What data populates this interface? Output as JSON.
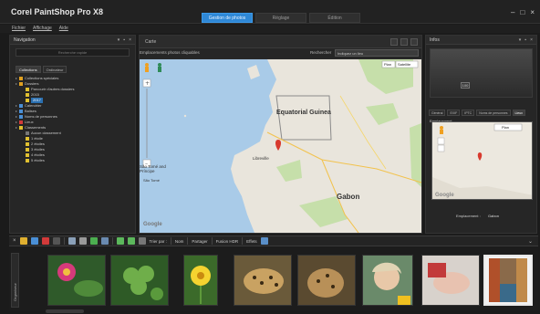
{
  "app": {
    "title": "Corel PaintShop Pro X8",
    "modes": [
      {
        "label": "Gestion de photos",
        "active": true
      },
      {
        "label": "Réglage",
        "active": false
      },
      {
        "label": "Édition",
        "active": false
      }
    ],
    "window_controls": [
      "–",
      "□",
      "×"
    ]
  },
  "menu": [
    "Fichier",
    "Affichage",
    "Aide"
  ],
  "navigation": {
    "title": "Navigation",
    "search_placeholder": "Recherche rapide",
    "tabs": [
      {
        "label": "Collections",
        "active": true
      },
      {
        "label": "Ordinateur",
        "active": false
      }
    ],
    "tree": [
      {
        "label": "Collections spéciales",
        "depth": 0,
        "icon_color": "#e0a020"
      },
      {
        "label": "Dossiers",
        "depth": 0,
        "icon_color": "#e0a020"
      },
      {
        "label": "Parcourir d'autres dossiers",
        "depth": 1,
        "icon_color": "#e0c030"
      },
      {
        "label": "2015",
        "depth": 1,
        "icon_color": "#e0c030"
      },
      {
        "label": "2017",
        "depth": 1,
        "icon_color": "#e0c030",
        "selected": true
      },
      {
        "label": "Calendrier",
        "depth": 0,
        "icon_color": "#4a8fd6"
      },
      {
        "label": "Balises",
        "depth": 0,
        "icon_color": "#4a8fd6"
      },
      {
        "label": "Noms de personnes",
        "depth": 0,
        "icon_color": "#4a8fd6"
      },
      {
        "label": "Lieux",
        "depth": 0,
        "icon_color": "#d23a3a"
      },
      {
        "label": "Classements",
        "depth": 0,
        "icon_color": "#e0c030"
      },
      {
        "label": "Aucun classement",
        "depth": 1,
        "icon_color": "#777"
      },
      {
        "label": "1 étoile",
        "depth": 1,
        "icon_color": "#e0c030"
      },
      {
        "label": "2 étoiles",
        "depth": 1,
        "icon_color": "#e0c030"
      },
      {
        "label": "3 étoiles",
        "depth": 1,
        "icon_color": "#e0c030"
      },
      {
        "label": "4 étoiles",
        "depth": 1,
        "icon_color": "#e0c030"
      },
      {
        "label": "5 étoiles",
        "depth": 1,
        "icon_color": "#e0c030"
      }
    ]
  },
  "map_panel": {
    "title": "Carte",
    "subtitle": "Emplacements photos cliquables",
    "search_label": "Rechercher",
    "search_value": "Indiquez un lieu",
    "map_types": [
      "Plan",
      "Satellite"
    ],
    "labels": {
      "country1": "Equatorial Guinea",
      "country2": "Gabon",
      "city": "Libreville",
      "island": "São Tomé and Príncipe",
      "island2": "São Tomé",
      "google": "Google"
    }
  },
  "info_panel": {
    "title": "Infos",
    "thumb_label": "100",
    "tabs": [
      {
        "label": "Général",
        "active": false
      },
      {
        "label": "EXIF",
        "active": false
      },
      {
        "label": "IPTC",
        "active": false
      },
      {
        "label": "Noms de personnes",
        "active": false
      },
      {
        "label": "Lieux",
        "active": true
      }
    ],
    "section": "Emplacement",
    "map_type": "Plan",
    "google": "Google",
    "footer_label": "Emplacement :",
    "footer_value": "Gabon"
  },
  "toolbar": {
    "sort_label": "Trier par :",
    "sort_value": "Nom",
    "partager": "Partager",
    "fusion": "Fusion HDR",
    "effets": "Effets"
  },
  "filmstrip": {
    "label": "Organiseur",
    "thumbs": [
      {
        "name": "pink-flower",
        "selected": false
      },
      {
        "name": "clover",
        "selected": false
      },
      {
        "name": "yellow-flower",
        "selected": false
      },
      {
        "name": "leopard-1",
        "selected": false
      },
      {
        "name": "leopard-2",
        "selected": false
      },
      {
        "name": "woman-portrait",
        "selected": false
      },
      {
        "name": "baby",
        "selected": false
      },
      {
        "name": "venice-canal",
        "selected": true
      }
    ]
  }
}
